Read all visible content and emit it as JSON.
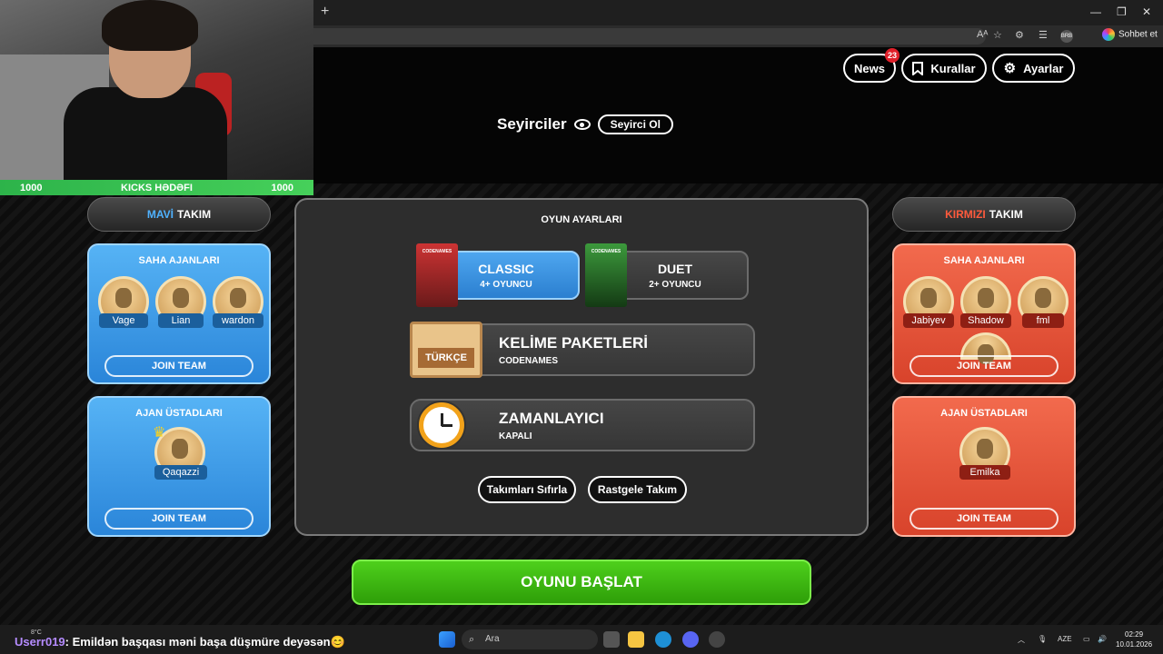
{
  "browser": {
    "chat_button": "Sohbet et",
    "profile_badge": "BRB"
  },
  "header": {
    "news_label": "News",
    "news_badge": "23",
    "rules_label": "Kurallar",
    "settings_label": "Ayarlar"
  },
  "spectators": {
    "title": "Seyirciler",
    "become_label": "Seyirci Ol"
  },
  "blue_team": {
    "name_prefix": "MAVİ",
    "name_suffix": "TAKIM",
    "operatives_title": "SAHA AJANLARI",
    "operatives": [
      "Vage",
      "Lian",
      "wardon"
    ],
    "spymasters_title": "AJAN ÜSTADLARI",
    "spymasters": [
      "Qaqazzi"
    ],
    "join_label": "JOIN TEAM"
  },
  "red_team": {
    "name_prefix": "KIRMIZI",
    "name_suffix": "TAKIM",
    "operatives_title": "SAHA AJANLARI",
    "operatives": [
      "Jabiyev",
      "Shadow",
      "fml"
    ],
    "spymasters_title": "AJAN ÜSTADLARI",
    "spymasters": [
      "Emilka"
    ],
    "join_label": "JOIN TEAM"
  },
  "game_settings": {
    "title": "OYUN AYARLARI",
    "modes": [
      {
        "name": "CLASSIC",
        "players": "4+ OYUNCU",
        "selected": true
      },
      {
        "name": "DUET",
        "players": "2+ OYUNCU",
        "selected": false
      }
    ],
    "word_packs": {
      "title": "KELİME PAKETLERİ",
      "value": "CODENAMES",
      "card_label": "TÜRKÇE"
    },
    "timer": {
      "title": "ZAMANLAYICI",
      "value": "KAPALI"
    },
    "reset_label": "Takımları Sıfırla",
    "random_label": "Rastgele Takım",
    "box_art_label": "CODENAMES"
  },
  "start_label": "OYUNU BAŞLAT",
  "stream": {
    "goal_left": "1000",
    "goal_title": "KICKS HƏDƏFI",
    "goal_right": "1000"
  },
  "chat_line": {
    "user": "Userr019",
    "message": ": Emildən başqası məni başa düşmüre deyəsən😊"
  },
  "taskbar": {
    "weather": "8°C",
    "search_placeholder": "Ara",
    "lang": "AZE",
    "time": "02:29",
    "date": "10.01.2026"
  },
  "colors": {
    "blue_accent": "#2a85d9",
    "red_accent": "#d8432b",
    "start_green": "#3cb412"
  }
}
